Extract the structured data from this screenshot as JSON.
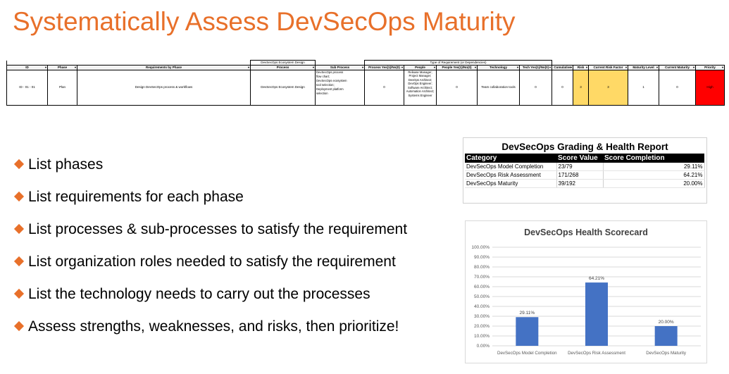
{
  "title": "Systematically Assess DevSecOps Maturity",
  "sheet": {
    "group_headers": {
      "ecosystem": "DevSecOps Ecosystem Design",
      "type_of_requirement": "Type of Requirement (or Dependencies)"
    },
    "columns": [
      "ID",
      "Phase",
      "Requirements by Phase",
      "Process",
      "Sub Process",
      "Process Yes(1)/No(0)",
      "People",
      "People Yes(1)/No(0)",
      "Technology",
      "Tech Yes(1)/No(0)",
      "Cumulative",
      "Risk",
      "Current Risk Factor",
      "Maturity Level",
      "Current Maturity",
      "Priority"
    ],
    "row": {
      "id": "ID - 01 - 01",
      "phase": "Plan",
      "requirement": "Design DevSecOps process & workflows",
      "process": "DevSecOps Ecosystem Design",
      "sub_process": [
        "DevSecOps process",
        "flow chart;",
        "DevSecOps ecosystem",
        "tool selection;",
        "Deployment platform",
        "selection"
      ],
      "process_yes_no": "0",
      "people": [
        "Release Manager;",
        "Project Manager;",
        "DevOps Architect;",
        "DevOps Engineer;",
        "Software Architect;",
        "Automation Architect;",
        "Systems Engineer"
      ],
      "people_yes_no": "0",
      "technology": "Team collaboration tools",
      "tech_yes_no": "0",
      "cumulative": "0",
      "risk": "3",
      "current_risk_factor": "3",
      "maturity_level": "1",
      "current_maturity": "0",
      "priority": "High"
    }
  },
  "bullets": [
    "List phases",
    "List requirements for each phase",
    "List processes & sub-processes to satisfy the requirement",
    "List organization roles needed to satisfy the requirement",
    "List the technology needs to carry out the processes",
    "Assess strengths, weaknesses, and risks, then prioritize!"
  ],
  "report": {
    "title": "DevSecOps Grading & Health Report",
    "headers": [
      "Category",
      "Score Value",
      "Score Completion"
    ],
    "rows": [
      {
        "category": "DevSecOps Model Completion",
        "score_value": "23/79",
        "completion": "29.11%"
      },
      {
        "category": "DevSecOps Risk Assessment",
        "score_value": "171/268",
        "completion": "64.21%"
      },
      {
        "category": "DevSecOps Maturity",
        "score_value": "39/192",
        "completion": "20.00%"
      }
    ]
  },
  "chart_data": {
    "type": "bar",
    "title": "DevSecOps Health Scorecard",
    "categories": [
      "DevSecOps Model Completion",
      "DevSecOps Risk Assessment",
      "DevSecOps Maturity"
    ],
    "values": [
      29.11,
      64.21,
      20.0
    ],
    "data_labels": [
      "29.11%",
      "64.21%",
      "20.00%"
    ],
    "ylim": [
      0,
      100
    ],
    "y_ticks": [
      "0.00%",
      "10.00%",
      "20.00%",
      "30.00%",
      "40.00%",
      "50.00%",
      "60.00%",
      "70.00%",
      "80.00%",
      "90.00%",
      "100.00%"
    ],
    "grid": true,
    "bar_color": "#4472c4"
  },
  "colors": {
    "accent": "#e8702a",
    "risk_yellow": "#ffd966",
    "priority_red": "#ff0000"
  }
}
